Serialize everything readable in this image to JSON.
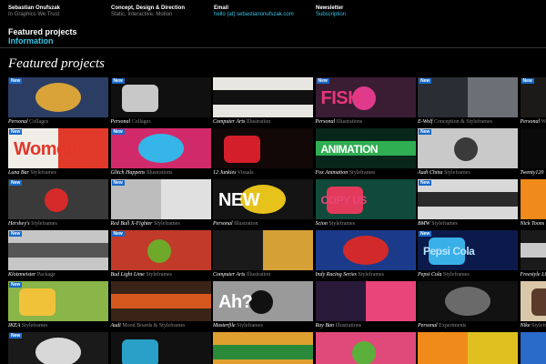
{
  "header": {
    "columns": [
      {
        "title": "Sebastian Onufszak",
        "sub": "In Graphics We Trust"
      },
      {
        "title": "Concept, Design & Direction",
        "sub": "Static, Interactive, Motion"
      },
      {
        "title": "Email",
        "link": "hello (at) sebastianonufszak.com"
      },
      {
        "title": "Newsletter",
        "link": "Subscription"
      }
    ]
  },
  "nav": {
    "featured": "Featured projects",
    "information": "Information"
  },
  "section_title": "Featured projects",
  "badge_label": "New",
  "rows": [
    [
      {
        "client": "Personal",
        "cat": "Collages",
        "new": true,
        "c1": "#2b3d63",
        "c2": "#d9a33a"
      },
      {
        "client": "Personal",
        "cat": "Collages",
        "new": true,
        "c1": "#101010",
        "c2": "#c8c8c8"
      },
      {
        "client": "Computer Arts",
        "cat": "Illustration",
        "new": false,
        "c1": "#e8e6e0",
        "c2": "#111111"
      },
      {
        "client": "Personal",
        "cat": "Illustrations",
        "new": true,
        "c1": "#3a1d33",
        "c2": "#e03a8c",
        "text": "FISH",
        "tcolor": "#e8367c"
      },
      {
        "client": "E-Wolf",
        "cat": "Conception & Styleframes",
        "new": true,
        "c1": "#2a2d33",
        "c2": "#6c7076"
      },
      {
        "client": "Personal",
        "cat": "W",
        "new": true,
        "c1": "#1c1a18",
        "c2": "#4d4640"
      }
    ],
    [
      {
        "client": "Luna Bar",
        "cat": "Styleframes",
        "new": true,
        "c1": "#f0eee6",
        "c2": "#e23a2a",
        "text": "Women",
        "tcolor": "#e2362a"
      },
      {
        "client": "Glitch Happens",
        "cat": "Illustrations",
        "new": true,
        "c1": "#d12a6b",
        "c2": "#36b5e8"
      },
      {
        "client": "12 Junkies",
        "cat": "Visuals",
        "new": false,
        "c1": "#120808",
        "c2": "#d41e2a"
      },
      {
        "client": "Fox Animation",
        "cat": "Styleframes",
        "new": false,
        "c1": "#08261a",
        "c2": "#2fae52",
        "text": "ANIMATION",
        "tcolor": "#ffffff"
      },
      {
        "client": "Audi China",
        "cat": "Styleframes",
        "new": true,
        "c1": "#c9c9c9",
        "c2": "#3a3a3a"
      },
      {
        "client": "Twenty120",
        "cat": "",
        "new": false,
        "c1": "#0a0a0a",
        "c2": "#c8d92a"
      }
    ],
    [
      {
        "client": "Hershey's",
        "cat": "Styleframes",
        "new": true,
        "c1": "#3a3a3a",
        "c2": "#d62a2a"
      },
      {
        "client": "Red Bull X-Fighter",
        "cat": "Styleframes",
        "new": true,
        "c1": "#bdbdbd",
        "c2": "#e0e0e0"
      },
      {
        "client": "Personal",
        "cat": "Illustration",
        "new": false,
        "c1": "#141414",
        "c2": "#e6c21a",
        "text": "NEW",
        "tcolor": "#ffffff"
      },
      {
        "client": "Scion",
        "cat": "Styleframes",
        "new": false,
        "c1": "#0f4a3a",
        "c2": "#e23a5a",
        "text": "COPY US",
        "tcolor": "#e8457a"
      },
      {
        "client": "BMW",
        "cat": "Styleframes",
        "new": true,
        "c1": "#d8d8d8",
        "c2": "#2a2a2a"
      },
      {
        "client": "Nick Toons",
        "cat": "",
        "new": false,
        "c1": "#f08a1a",
        "c2": "#1f8de0"
      }
    ],
    [
      {
        "client": "Klotzmeister",
        "cat": "Package",
        "new": true,
        "c1": "#c6c6c6",
        "c2": "#555555"
      },
      {
        "client": "Bud Light Lime",
        "cat": "Styleframes",
        "new": true,
        "c1": "#c23a2a",
        "c2": "#6fa92a"
      },
      {
        "client": "Computer Arts",
        "cat": "Illustration",
        "new": false,
        "c1": "#1a1a1a",
        "c2": "#d5a035"
      },
      {
        "client": "Indy Racing Series",
        "cat": "Styleframes",
        "new": false,
        "c1": "#1c3a8a",
        "c2": "#d22a2a"
      },
      {
        "client": "Pepsi Cola",
        "cat": "Styleframes",
        "new": true,
        "c1": "#0b1a4a",
        "c2": "#3ab0e8",
        "text": "Pepsi Cola",
        "tcolor": "#b8e4ff"
      },
      {
        "client": "Freestyle Li",
        "cat": "",
        "new": false,
        "c1": "#1a1a1a",
        "c2": "#c9c9c9"
      }
    ],
    [
      {
        "client": "IKEA",
        "cat": "Styleframes",
        "new": true,
        "c1": "#8ab548",
        "c2": "#f0c23a"
      },
      {
        "client": "Audi",
        "cat": "Mood Boards & Styleframes",
        "new": false,
        "c1": "#3a2418",
        "c2": "#d5581e"
      },
      {
        "client": "Masterfile",
        "cat": "Styleframes",
        "new": false,
        "c1": "#9a9a9a",
        "c2": "#111111",
        "text": "Ah?",
        "tcolor": "#ffffff"
      },
      {
        "client": "Ray Ban",
        "cat": "Illustrations",
        "new": false,
        "c1": "#2a1a3a",
        "c2": "#e8457a"
      },
      {
        "client": "Personal",
        "cat": "Experiments",
        "new": false,
        "c1": "#121212",
        "c2": "#6a6a6a"
      },
      {
        "client": "Nike",
        "cat": "Styleframes",
        "new": false,
        "c1": "#d8c8a8",
        "c2": "#5a3a2a"
      }
    ],
    [
      {
        "client": "",
        "cat": "",
        "new": true,
        "c1": "#1a1a1a",
        "c2": "#d8d8d8"
      },
      {
        "client": "",
        "cat": "",
        "new": false,
        "c1": "#111111",
        "c2": "#2aa0c8"
      },
      {
        "client": "",
        "cat": "",
        "new": false,
        "c1": "#e0a030",
        "c2": "#2a8a3a"
      },
      {
        "client": "",
        "cat": "",
        "new": false,
        "c1": "#e04a7a",
        "c2": "#5ab03a"
      },
      {
        "client": "",
        "cat": "",
        "new": false,
        "c1": "#f08a1a",
        "c2": "#e0c020"
      },
      {
        "client": "",
        "cat": "",
        "new": false,
        "c1": "#2a6ac8",
        "c2": "#ea8a2a"
      }
    ]
  ],
  "colors": {
    "accent": "#39c3e6",
    "badge": "#1769c8",
    "muted": "#8a8a8a"
  }
}
